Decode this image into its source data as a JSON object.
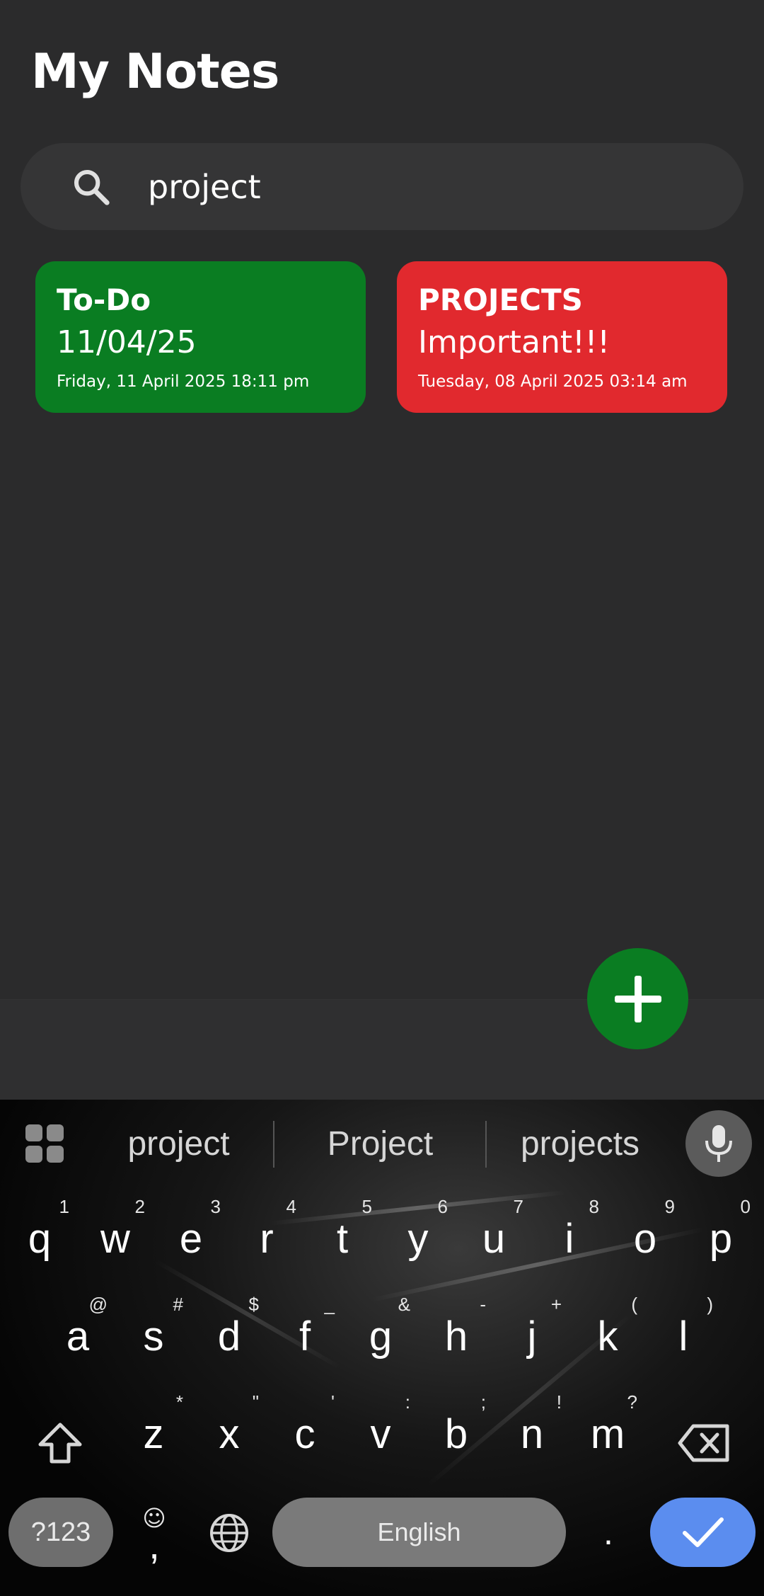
{
  "app": {
    "title": "My Notes",
    "search": {
      "value": "project",
      "icon": "search-icon"
    },
    "notes": [
      {
        "title": "To-Do",
        "body": "11/04/25",
        "date": "Friday, 11 April 2025 18:11 pm",
        "color": "#0a7d22"
      },
      {
        "title": "PROJECTS",
        "body": "Important!!!",
        "date": "Tuesday, 08 April 2025 03:14 am",
        "color": "#e1292e"
      }
    ],
    "fab": {
      "icon": "plus-icon",
      "color": "#0a7d22"
    }
  },
  "keyboard": {
    "suggestions": [
      "project",
      "Project",
      "projects"
    ],
    "row1": [
      {
        "k": "q",
        "h": "1"
      },
      {
        "k": "w",
        "h": "2"
      },
      {
        "k": "e",
        "h": "3"
      },
      {
        "k": "r",
        "h": "4"
      },
      {
        "k": "t",
        "h": "5"
      },
      {
        "k": "y",
        "h": "6"
      },
      {
        "k": "u",
        "h": "7"
      },
      {
        "k": "i",
        "h": "8"
      },
      {
        "k": "o",
        "h": "9"
      },
      {
        "k": "p",
        "h": "0"
      }
    ],
    "row2": [
      {
        "k": "a",
        "h": "@"
      },
      {
        "k": "s",
        "h": "#"
      },
      {
        "k": "d",
        "h": "$"
      },
      {
        "k": "f",
        "h": "_"
      },
      {
        "k": "g",
        "h": "&"
      },
      {
        "k": "h",
        "h": "-"
      },
      {
        "k": "j",
        "h": "+"
      },
      {
        "k": "k",
        "h": "("
      },
      {
        "k": "l",
        "h": ")"
      }
    ],
    "row3": [
      {
        "k": "z",
        "h": "*"
      },
      {
        "k": "x",
        "h": "\""
      },
      {
        "k": "c",
        "h": "'"
      },
      {
        "k": "v",
        "h": ":"
      },
      {
        "k": "b",
        "h": ";"
      },
      {
        "k": "n",
        "h": "!"
      },
      {
        "k": "m",
        "h": "?"
      }
    ],
    "symbols_label": "?123",
    "comma": ",",
    "emoji": "☺",
    "space_label": "English",
    "period": ".",
    "enter_color": "#5b8def"
  }
}
